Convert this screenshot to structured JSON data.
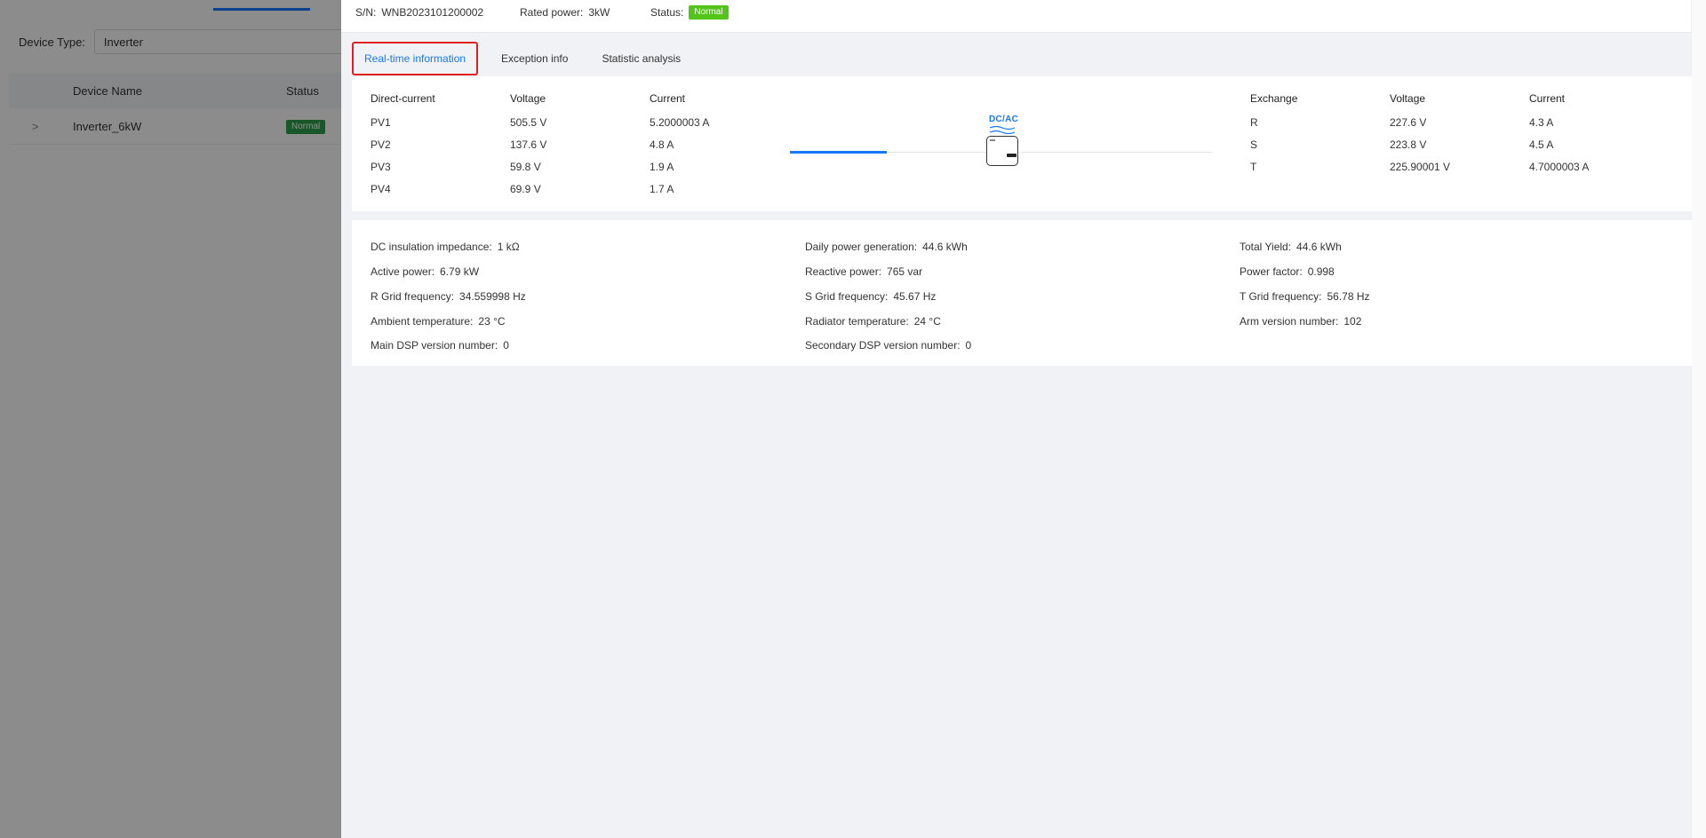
{
  "background": {
    "filter_label": "Device Type:",
    "filter_value": "Inverter",
    "table_headers": [
      "Device Name",
      "Status"
    ],
    "row": {
      "name": "Inverter_6kW",
      "status": "Normal",
      "expand_glyph": ">"
    }
  },
  "drawer": {
    "header": {
      "sn_label": "S/N:",
      "sn_value": "WNB2023101200002",
      "rated_label": "Rated power:",
      "rated_value": "3kW",
      "status_label": "Status:",
      "status_value": "Normal"
    },
    "tabs": [
      {
        "label": "Real-time information",
        "active": true
      },
      {
        "label": "Exception info",
        "active": false
      },
      {
        "label": "Statistic analysis",
        "active": false
      }
    ],
    "dc_table": {
      "headers": [
        "Direct-current",
        "Voltage",
        "Current"
      ],
      "rows": [
        [
          "PV1",
          "505.5 V",
          "5.2000003 A"
        ],
        [
          "PV2",
          "137.6 V",
          "4.8 A"
        ],
        [
          "PV3",
          "59.8 V",
          "1.9 A"
        ],
        [
          "PV4",
          "69.9 V",
          "1.7 A"
        ]
      ]
    },
    "diagram": {
      "label": "DC/AC",
      "icon": "inverter-icon"
    },
    "ac_table": {
      "headers": [
        "Exchange",
        "Voltage",
        "Current"
      ],
      "rows": [
        [
          "R",
          "227.6 V",
          "4.3 A"
        ],
        [
          "S",
          "223.8 V",
          "4.5 A"
        ],
        [
          "T",
          "225.90001 V",
          "4.7000003 A"
        ]
      ]
    },
    "info": [
      [
        {
          "label": "DC insulation impedance:",
          "value": "1 kΩ"
        },
        {
          "label": "Daily power generation:",
          "value": "44.6 kWh"
        },
        {
          "label": "Total Yield:",
          "value": "44.6 kWh"
        }
      ],
      [
        {
          "label": "Active power:",
          "value": "6.79 kW"
        },
        {
          "label": "Reactive power:",
          "value": "765 var"
        },
        {
          "label": "Power factor:",
          "value": "0.998"
        }
      ],
      [
        {
          "label": "R Grid frequency:",
          "value": "34.559998 Hz"
        },
        {
          "label": "S Grid frequency:",
          "value": "45.67 Hz"
        },
        {
          "label": "T Grid frequency:",
          "value": "56.78 Hz"
        }
      ],
      [
        {
          "label": "Ambient temperature:",
          "value": "23 °C"
        },
        {
          "label": "Radiator temperature:",
          "value": "24 °C"
        },
        {
          "label": "Arm version number:",
          "value": "102"
        }
      ],
      [
        {
          "label": "Main DSP version number:",
          "value": "0"
        },
        {
          "label": "Secondary DSP version number:",
          "value": "0"
        }
      ]
    ]
  },
  "colors": {
    "accent": "#1677ff",
    "status_green": "#52c41a",
    "highlight_red": "#e02020"
  }
}
